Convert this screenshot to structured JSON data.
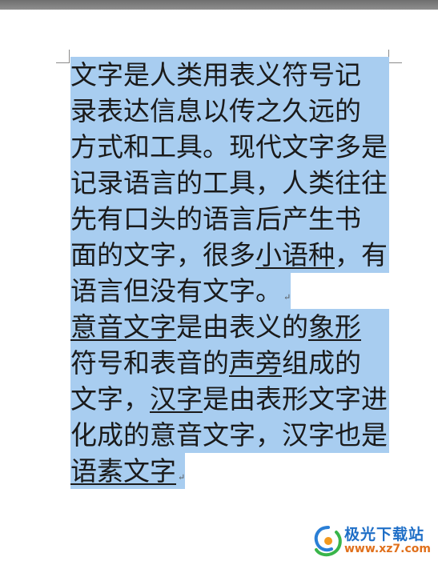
{
  "document": {
    "lines": [
      {
        "segments": [
          {
            "text": "文字是人类用表义符号记"
          }
        ]
      },
      {
        "segments": [
          {
            "text": "录表达信息以传之久远的"
          }
        ]
      },
      {
        "segments": [
          {
            "text": "方式和工具。现代文字多是"
          }
        ]
      },
      {
        "segments": [
          {
            "text": "记录语言的工具，人类往往"
          }
        ]
      },
      {
        "segments": [
          {
            "text": "先有口头的语言后产生书"
          }
        ]
      },
      {
        "segments": [
          {
            "text": "面的文字，很多"
          },
          {
            "text": "小语种",
            "u": true
          },
          {
            "text": "，有"
          }
        ]
      },
      {
        "segments": [
          {
            "text": "语言但没有文字。"
          }
        ],
        "mark": true
      },
      {
        "segments": [
          {
            "text": "意音文字",
            "u": true
          },
          {
            "text": "是由表义的"
          },
          {
            "text": "象形",
            "u": true
          }
        ]
      },
      {
        "segments": [
          {
            "text": "符号和表音的"
          },
          {
            "text": "声旁",
            "u": true
          },
          {
            "text": "组成的"
          }
        ]
      },
      {
        "segments": [
          {
            "text": "文字，"
          },
          {
            "text": "汉字",
            "u": true
          },
          {
            "text": "是由表形文字进"
          }
        ]
      },
      {
        "segments": [
          {
            "text": "化成的意音文字，汉字也是"
          }
        ]
      },
      {
        "segments": [
          {
            "text": "语素文字",
            "u": true
          }
        ],
        "mark": true
      }
    ],
    "paragraph_mark": "↵"
  },
  "watermark": {
    "title": "极光下载站",
    "url": "www.xz7.com"
  },
  "colors": {
    "selection": "#a8cdf0",
    "page": "#ffffff",
    "workspace": "#a9a9a9"
  }
}
